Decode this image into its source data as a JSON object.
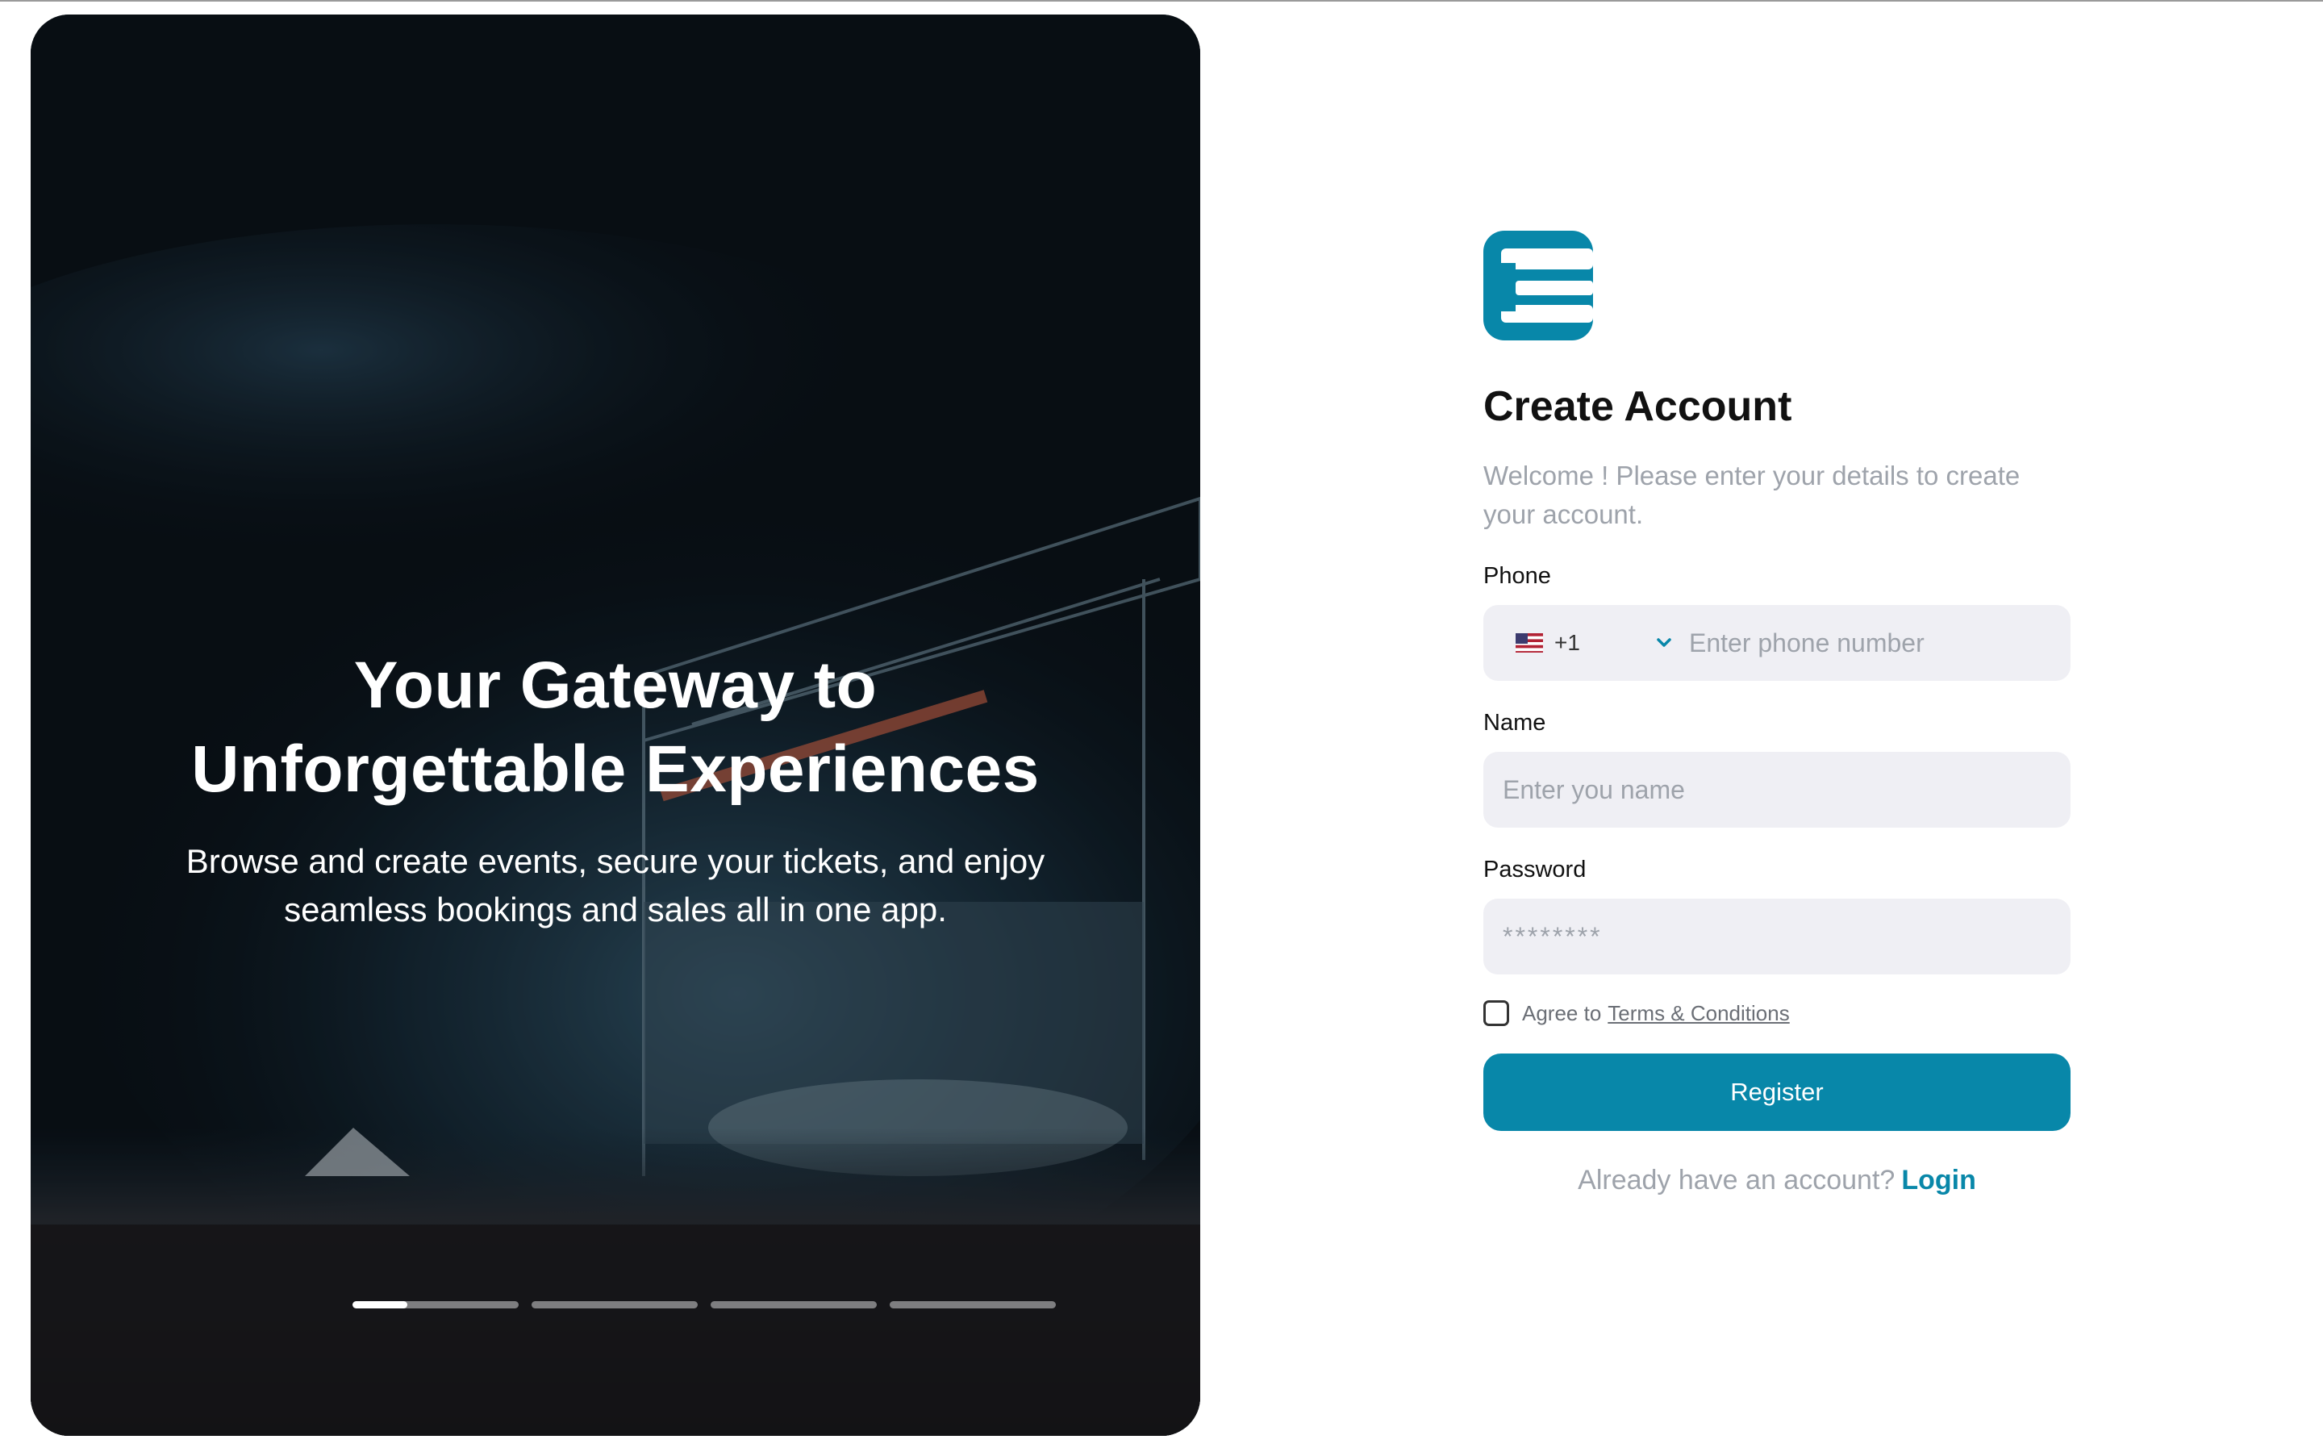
{
  "hero": {
    "title_line1": "Your Gateway to",
    "title_line2": "Unforgettable Experiences",
    "subtitle": "Browse and create events, secure your tickets, and enjoy seamless bookings and sales all in one app.",
    "carousel": {
      "total_slides": 4,
      "active_slide": 1,
      "active_progress": 0.33
    },
    "background_image": "concert-stage-crowd"
  },
  "brand": {
    "logo_icon": "brand-logo-icon",
    "accent_color": "#0887a9"
  },
  "form": {
    "title": "Create Account",
    "welcome": "Welcome ! Please enter your details to create your account.",
    "phone": {
      "label": "Phone",
      "flag_icon": "us-flag-icon",
      "country_code": "+1",
      "placeholder": "Enter phone number"
    },
    "name": {
      "label": "Name",
      "placeholder": "Enter you name"
    },
    "password": {
      "label": "Password",
      "placeholder": "********"
    },
    "agree": {
      "text": "Agree to",
      "link": "Terms & Conditions",
      "checked": false
    },
    "register_label": "Register",
    "already_text": "Already have an account?",
    "login_label": "Login"
  }
}
